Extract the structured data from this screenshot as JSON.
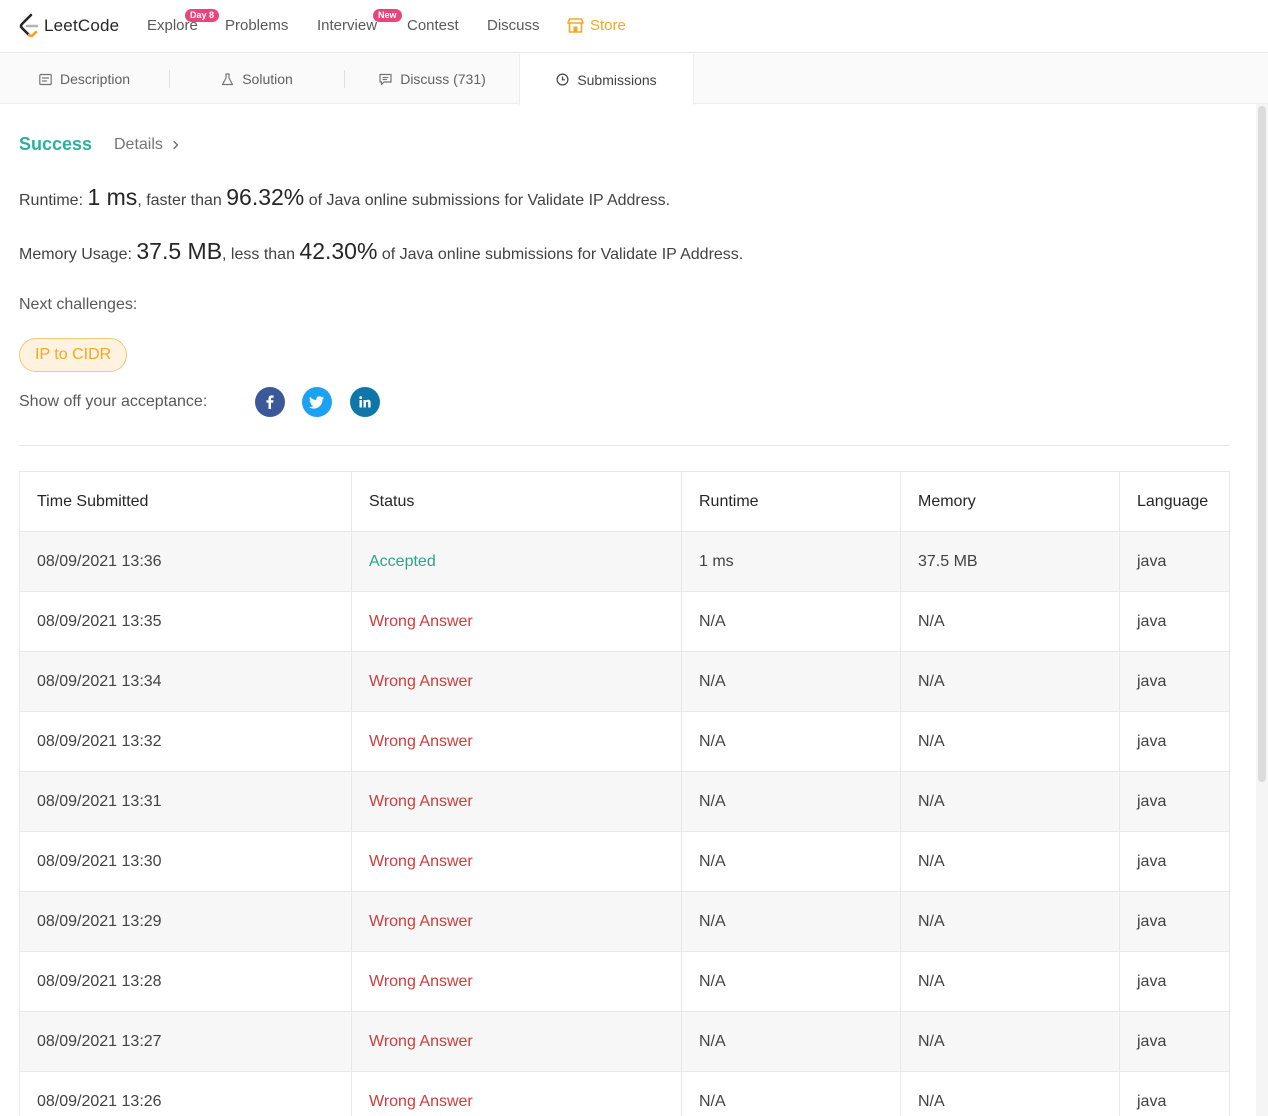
{
  "nav": {
    "logo_text": "LeetCode",
    "items": [
      {
        "label": "Explore",
        "badge": "Day 8"
      },
      {
        "label": "Problems"
      },
      {
        "label": "Interview",
        "badge": "New"
      },
      {
        "label": "Contest"
      },
      {
        "label": "Discuss"
      },
      {
        "label": "Store"
      }
    ]
  },
  "tabs": [
    {
      "label": "Description",
      "icon": "description-icon"
    },
    {
      "label": "Solution",
      "icon": "flask-icon"
    },
    {
      "label": "Discuss (731)",
      "icon": "comment-icon"
    },
    {
      "label": "Submissions",
      "icon": "clock-icon",
      "active": true
    }
  ],
  "result": {
    "status": "Success",
    "details_label": "Details",
    "runtime": {
      "prefix": "Runtime: ",
      "value": "1 ms",
      "mid": ", faster than ",
      "pct": "96.32%",
      "suffix": " of Java online submissions for Validate IP Address."
    },
    "memory": {
      "prefix": "Memory Usage: ",
      "value": "37.5 MB",
      "mid": ", less than ",
      "pct": "42.30%",
      "suffix": " of Java online submissions for Validate IP Address."
    },
    "next_label": "Next challenges:",
    "next_challenge": "IP to CIDR",
    "share_label": "Show off your acceptance:"
  },
  "colors": {
    "success": "#2db09c",
    "accepted": "#2aa389",
    "wrong": "#d03b3b",
    "store": "#f5a623",
    "facebook": "#3b5998",
    "twitter": "#1da1f2",
    "linkedin": "#0e76a8"
  },
  "table": {
    "headers": [
      "Time Submitted",
      "Status",
      "Runtime",
      "Memory",
      "Language"
    ],
    "rows": [
      {
        "time": "08/09/2021 13:36",
        "status": "Accepted",
        "runtime": "1 ms",
        "memory": "37.5 MB",
        "language": "java"
      },
      {
        "time": "08/09/2021 13:35",
        "status": "Wrong Answer",
        "runtime": "N/A",
        "memory": "N/A",
        "language": "java"
      },
      {
        "time": "08/09/2021 13:34",
        "status": "Wrong Answer",
        "runtime": "N/A",
        "memory": "N/A",
        "language": "java"
      },
      {
        "time": "08/09/2021 13:32",
        "status": "Wrong Answer",
        "runtime": "N/A",
        "memory": "N/A",
        "language": "java"
      },
      {
        "time": "08/09/2021 13:31",
        "status": "Wrong Answer",
        "runtime": "N/A",
        "memory": "N/A",
        "language": "java"
      },
      {
        "time": "08/09/2021 13:30",
        "status": "Wrong Answer",
        "runtime": "N/A",
        "memory": "N/A",
        "language": "java"
      },
      {
        "time": "08/09/2021 13:29",
        "status": "Wrong Answer",
        "runtime": "N/A",
        "memory": "N/A",
        "language": "java"
      },
      {
        "time": "08/09/2021 13:28",
        "status": "Wrong Answer",
        "runtime": "N/A",
        "memory": "N/A",
        "language": "java"
      },
      {
        "time": "08/09/2021 13:27",
        "status": "Wrong Answer",
        "runtime": "N/A",
        "memory": "N/A",
        "language": "java"
      },
      {
        "time": "08/09/2021 13:26",
        "status": "Wrong Answer",
        "runtime": "N/A",
        "memory": "N/A",
        "language": "java"
      }
    ]
  }
}
